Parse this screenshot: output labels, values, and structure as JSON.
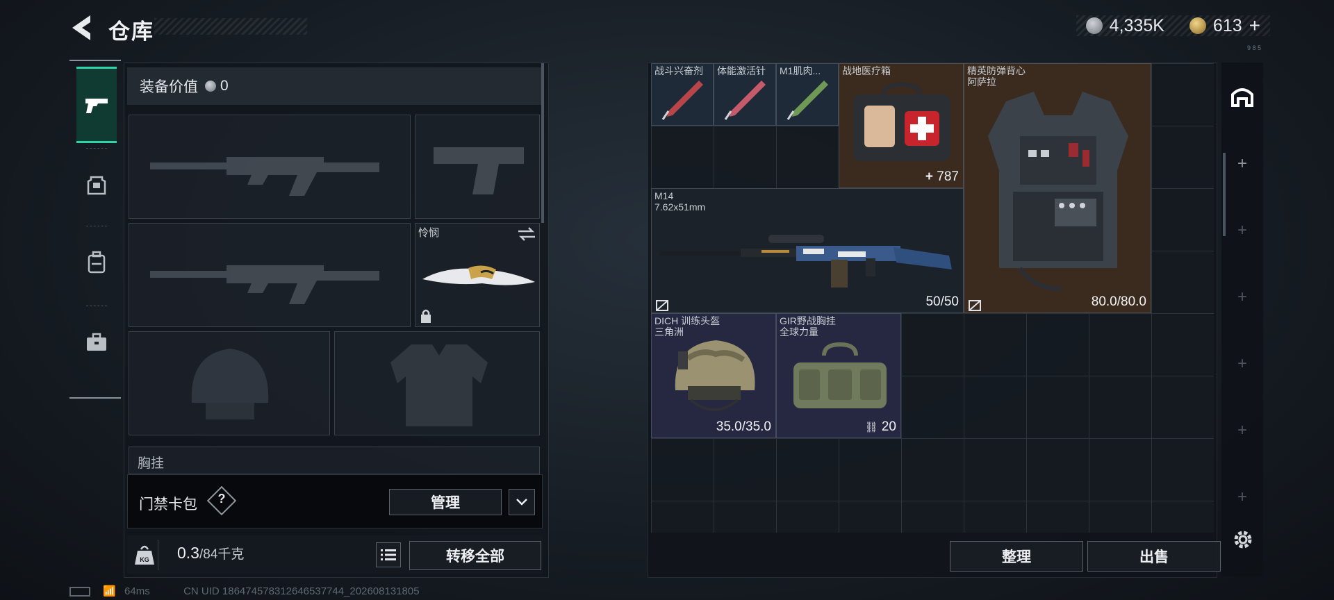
{
  "header": {
    "title": "仓库",
    "currency_silver": "4,335K",
    "currency_gold": "613",
    "version_tag": "9 8 5"
  },
  "tabs": [
    {
      "name": "weapons",
      "icon": "pistol-icon",
      "active": true
    },
    {
      "name": "armor",
      "icon": "rig-icon"
    },
    {
      "name": "backpack",
      "icon": "backpack-icon"
    },
    {
      "name": "case",
      "icon": "briefcase-icon"
    }
  ],
  "loadout": {
    "equip_value_label": "装备价值",
    "equip_value": "0",
    "melee_name": "怜悯",
    "chest_rig_partial": "胸挂",
    "card_pack_label": "门禁卡包",
    "help_mark": "?",
    "manage_label": "管理",
    "weight_value": "0.3",
    "weight_max": "/84千克",
    "transfer_all_label": "转移全部"
  },
  "stash": {
    "items": [
      {
        "name": "战斗兴奋剂"
      },
      {
        "name": "体能激活针"
      },
      {
        "name": "M1肌肉..."
      },
      {
        "name": "战地医疗箱",
        "value": "787"
      },
      {
        "name": "精英防弹背心",
        "sub": "阿萨拉",
        "value": "80.0/80.0"
      },
      {
        "name": "M14",
        "sub": "7.62x51mm",
        "value": "50/50"
      },
      {
        "name": "DICH 训练头盔",
        "sub": "三角洲",
        "value": "35.0/35.0"
      },
      {
        "name": "GIR野战胸挂",
        "sub": "全球力量",
        "value": "20"
      }
    ],
    "sort_label": "整理",
    "sell_label": "出售"
  },
  "status": {
    "ping": "64ms",
    "uid": "CN UID 1864745783126465377​44_202608131805"
  },
  "colors": {
    "accent_green": "#2fd4a8",
    "tab_active_bg": "#0f3b33",
    "gold_item_bg": "#3b2a1e",
    "blue_item_bg": "#1f2a38",
    "purple_item_bg": "#262842"
  }
}
